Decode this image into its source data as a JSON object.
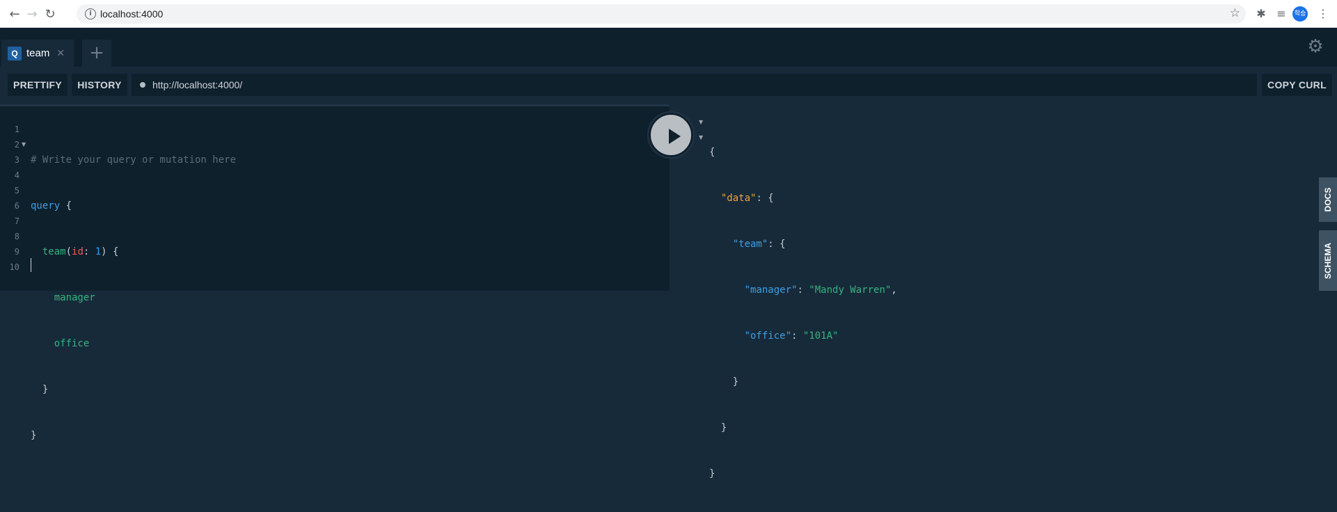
{
  "browser": {
    "url": "localhost:4000",
    "avatar_text": "학승"
  },
  "tabs": [
    {
      "badge": "Q",
      "label": "team"
    }
  ],
  "toolbar": {
    "prettify_label": "PRETTIFY",
    "history_label": "HISTORY",
    "endpoint": "http://localhost:4000/",
    "copy_curl_label": "COPY CURL"
  },
  "query_editor": {
    "line_numbers": [
      "1",
      "2",
      "3",
      "4",
      "5",
      "6",
      "7",
      "8",
      "9",
      "10"
    ],
    "comment": "# Write your query or mutation here",
    "keyword": "query",
    "field": "team",
    "arg_name": "id",
    "arg_value": "1",
    "subfields": [
      "manager",
      "office"
    ]
  },
  "result": {
    "data_key": "\"data\"",
    "team_key": "\"team\"",
    "manager_key": "\"manager\"",
    "manager_value": "\"Mandy Warren\"",
    "office_key": "\"office\"",
    "office_value": "\"101A\""
  },
  "side_tabs": {
    "docs": "DOCS",
    "schema": "SCHEMA"
  },
  "colors": {
    "background": "#172a3a",
    "editor_bg": "#0f202d",
    "keyword": "#3f9fe3",
    "field": "#36b37e",
    "argument": "#f25c54",
    "data_key": "#f2a33a"
  }
}
